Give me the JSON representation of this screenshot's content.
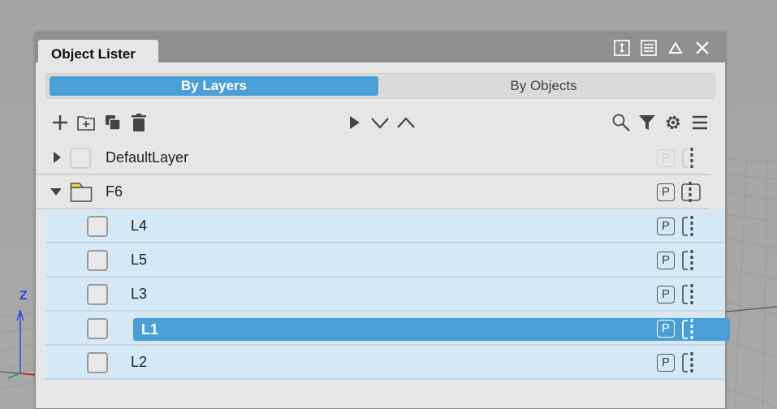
{
  "window": {
    "title": "Object Lister",
    "title_icons": [
      "resize-vertical-icon",
      "list-window-icon",
      "collapse-triangle-icon",
      "close-icon"
    ]
  },
  "view_toggle": {
    "active": "By Layers",
    "inactive": "By Objects"
  },
  "toolbar": {
    "left": [
      "add-icon",
      "add-group-icon",
      "duplicate-icon",
      "trash-icon"
    ],
    "center": [
      "play-icon",
      "chevron-down-icon",
      "chevron-up-icon"
    ],
    "right": [
      "search-icon",
      "filter-icon",
      "gear-icon",
      "menu-icon"
    ]
  },
  "tree": {
    "items": [
      {
        "label": "DefaultLayer",
        "level": 0,
        "expanded": false,
        "badge": "P"
      },
      {
        "label": "F6",
        "level": 0,
        "expanded": true,
        "badge": "P"
      },
      {
        "label": "L4",
        "level": 1,
        "selected": false,
        "badge": "P"
      },
      {
        "label": "L5",
        "level": 1,
        "selected": false,
        "badge": "P"
      },
      {
        "label": "L3",
        "level": 1,
        "selected": false,
        "badge": "P"
      },
      {
        "label": "L1",
        "level": 1,
        "selected": true,
        "badge": "P"
      },
      {
        "label": "L2",
        "level": 1,
        "selected": false,
        "badge": "P"
      }
    ]
  },
  "axis": {
    "z_label": "Z"
  },
  "colors": {
    "accent": "#4a9fd6",
    "child_row_bg": "#d4e8f6",
    "panel_bg": "#e6e6e6",
    "titlebar_bg": "#8f8f8f",
    "folder_tab": "#f2d43a"
  }
}
